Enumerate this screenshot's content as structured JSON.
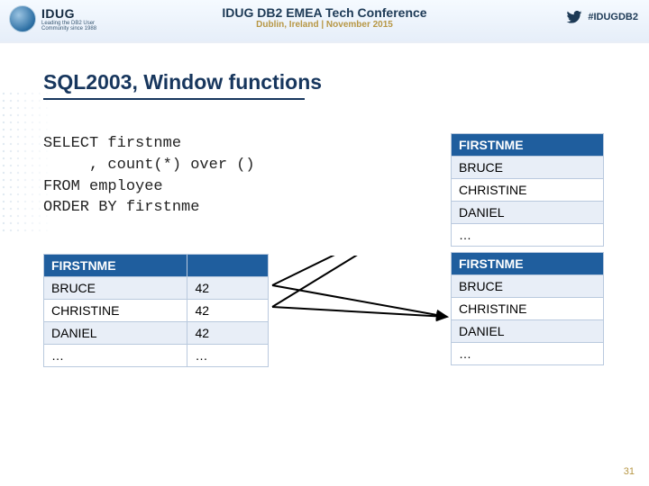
{
  "header": {
    "logo_main": "IDUG",
    "logo_sub_line1": "Leading the DB2 User",
    "logo_sub_line2": "Community since 1988",
    "conf_title": "IDUG DB2 EMEA Tech Conference",
    "conf_sub": "Dublin, Ireland  |  November 2015",
    "hashtag": "#IDUGDB2"
  },
  "title": "SQL2003, Window functions",
  "sql": "SELECT firstnme\n     , count(*) over ()\nFROM employee\nORDER BY firstnme",
  "table_left": {
    "col1": "FIRSTNME",
    "col2": "",
    "rows": [
      {
        "name": "BRUCE",
        "cnt": "42"
      },
      {
        "name": "CHRISTINE",
        "cnt": "42"
      },
      {
        "name": "DANIEL",
        "cnt": "42"
      },
      {
        "name": "…",
        "cnt": "…"
      }
    ]
  },
  "table_top": {
    "col1": "FIRSTNME",
    "rows": [
      "BRUCE",
      "CHRISTINE",
      "DANIEL",
      "…"
    ]
  },
  "table_bot": {
    "col1": "FIRSTNME",
    "rows": [
      "BRUCE",
      "CHRISTINE",
      "DANIEL",
      "…"
    ]
  },
  "page_number": "31"
}
